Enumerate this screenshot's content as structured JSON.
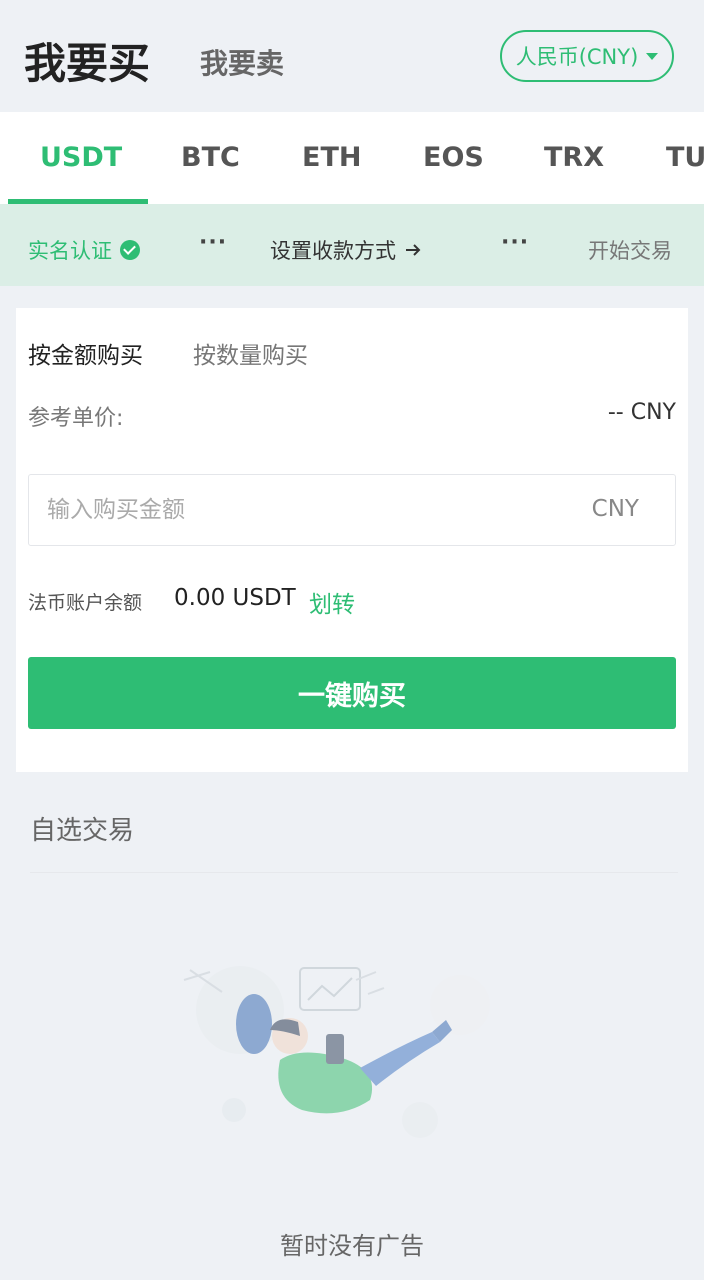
{
  "header": {
    "buy_tab": "我要买",
    "sell_tab": "我要卖",
    "currency": "人民币(CNY)"
  },
  "coins": [
    "USDT",
    "BTC",
    "ETH",
    "EOS",
    "TRX",
    "TU"
  ],
  "active_coin": "USDT",
  "steps": {
    "verify": "实名认证",
    "payment": "设置收款方式",
    "trade": "开始交易"
  },
  "buy_card": {
    "mode_amount": "按金额购买",
    "mode_quantity": "按数量购买",
    "ref_price_label": "参考单价:",
    "ref_price_value": "-- CNY",
    "amount_placeholder": "输入购买金额",
    "amount_unit": "CNY",
    "balance_label": "法币账户余额",
    "balance_value": "0.00 USDT",
    "transfer_link": "划转",
    "buy_button": "一键购买"
  },
  "favorites": {
    "title": "自选交易",
    "empty_text": "暂时没有广告"
  },
  "colors": {
    "accent": "#2ebd74",
    "background": "#eef1f5",
    "steps_bg": "#dbeee6"
  }
}
